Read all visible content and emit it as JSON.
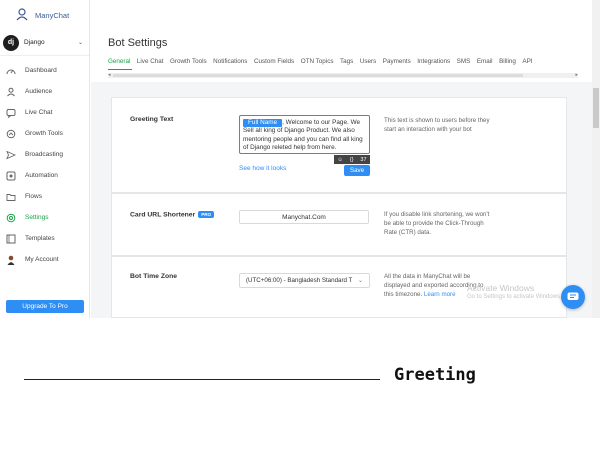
{
  "brand": {
    "name": "ManyChat"
  },
  "account": {
    "name": "Django",
    "avatar_text": "dj"
  },
  "sidebar": {
    "items": [
      {
        "label": "Dashboard",
        "icon": "dashboard-icon"
      },
      {
        "label": "Audience",
        "icon": "user-icon"
      },
      {
        "label": "Live Chat",
        "icon": "chat-icon"
      },
      {
        "label": "Growth Tools",
        "icon": "growth-icon"
      },
      {
        "label": "Broadcasting",
        "icon": "send-icon"
      },
      {
        "label": "Automation",
        "icon": "automation-icon"
      },
      {
        "label": "Flows",
        "icon": "folder-icon"
      },
      {
        "label": "Settings",
        "icon": "gear-icon"
      },
      {
        "label": "Templates",
        "icon": "templates-icon"
      },
      {
        "label": "My Account",
        "icon": "avatar-icon"
      }
    ],
    "active": "Settings",
    "upgrade_label": "Upgrade To Pro"
  },
  "header": {
    "title": "Bot Settings",
    "tabs": [
      "General",
      "Live Chat",
      "Growth Tools",
      "Notifications",
      "Custom Fields",
      "OTN Topics",
      "Tags",
      "Users",
      "Payments",
      "Integrations",
      "SMS",
      "Email",
      "Billing",
      "API"
    ],
    "active_tab": "General"
  },
  "greeting": {
    "label": "Greeting Text",
    "chip": "Full Name",
    "text_after_chip": ", Welcome to our Page.",
    "text_body": "We Sell all king of Django Product. We also mentoring people and you can find all king of Django releted help from here.",
    "counter": "37",
    "save_label": "Save",
    "see_how": "See how it looks",
    "description": "This text is shown to users before they start an interaction with your bot"
  },
  "url_shortener": {
    "label": "Card URL Shortener",
    "badge": "PRO",
    "value": "Manychat.Com",
    "description": "If you disable link shortening, we won't be able to provide the Click-Through Rate (CTR) data."
  },
  "timezone": {
    "label": "Bot Time Zone",
    "value": "(UTC+06:00) - Bangladesh Standard T",
    "description": "All the data in ManyChat will be displayed and exported according to this timezone.",
    "learn_more": "Learn more"
  },
  "windows_overlay": {
    "line1": "Activate Windows",
    "line2": "Go to Settings to activate Windows."
  },
  "caption": "Greeting"
}
